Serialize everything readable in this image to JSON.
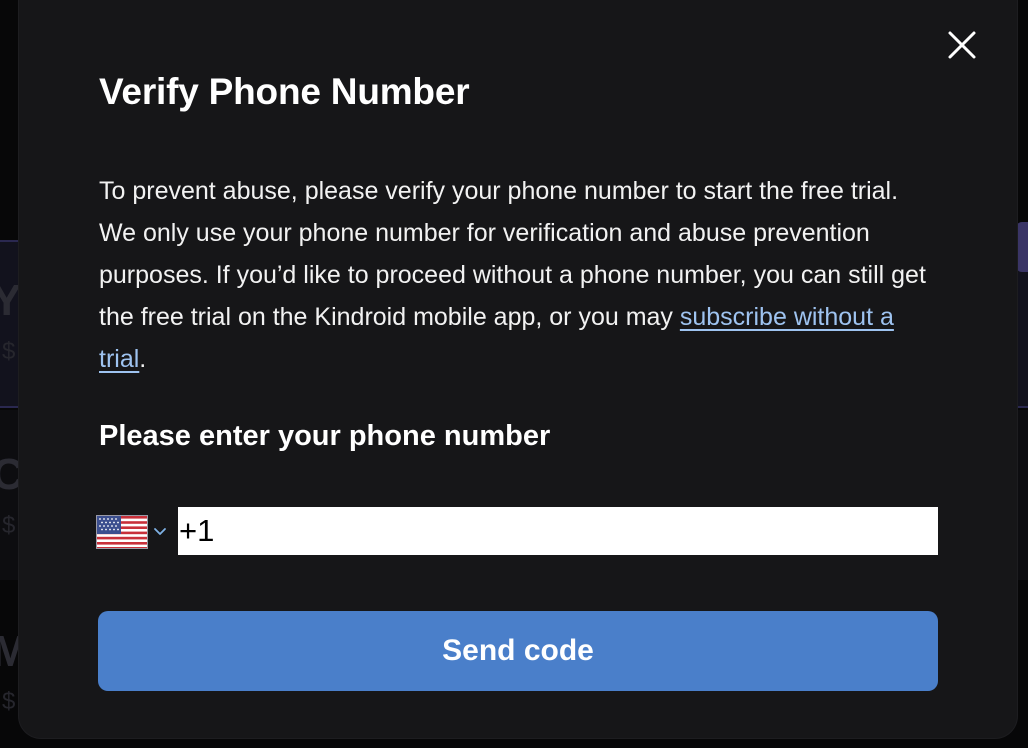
{
  "background": {
    "fragments": [
      "Y",
      "$",
      "C",
      "$",
      "M",
      "$"
    ]
  },
  "modal": {
    "title": "Verify Phone Number",
    "close_icon": "close-icon",
    "description_before_link": "To prevent abuse, please verify your phone number to start the free trial. We only use your phone number for verification and abuse prevention purposes. If you’d like to proceed without a phone number, you can still get the free trial on the Kindroid mobile app, or you may ",
    "description_link": "subscribe without a trial",
    "description_after_link": ".",
    "phone_label": "Please enter your phone number",
    "country_flag_icon": "us-flag-icon",
    "country_chevron_icon": "chevron-down-icon",
    "phone_value": "+1",
    "send_button_label": "Send code"
  },
  "colors": {
    "modal_background": "#161618",
    "link": "#9ec3f0",
    "button": "#4a7fca",
    "input_background": "#ffffff"
  }
}
